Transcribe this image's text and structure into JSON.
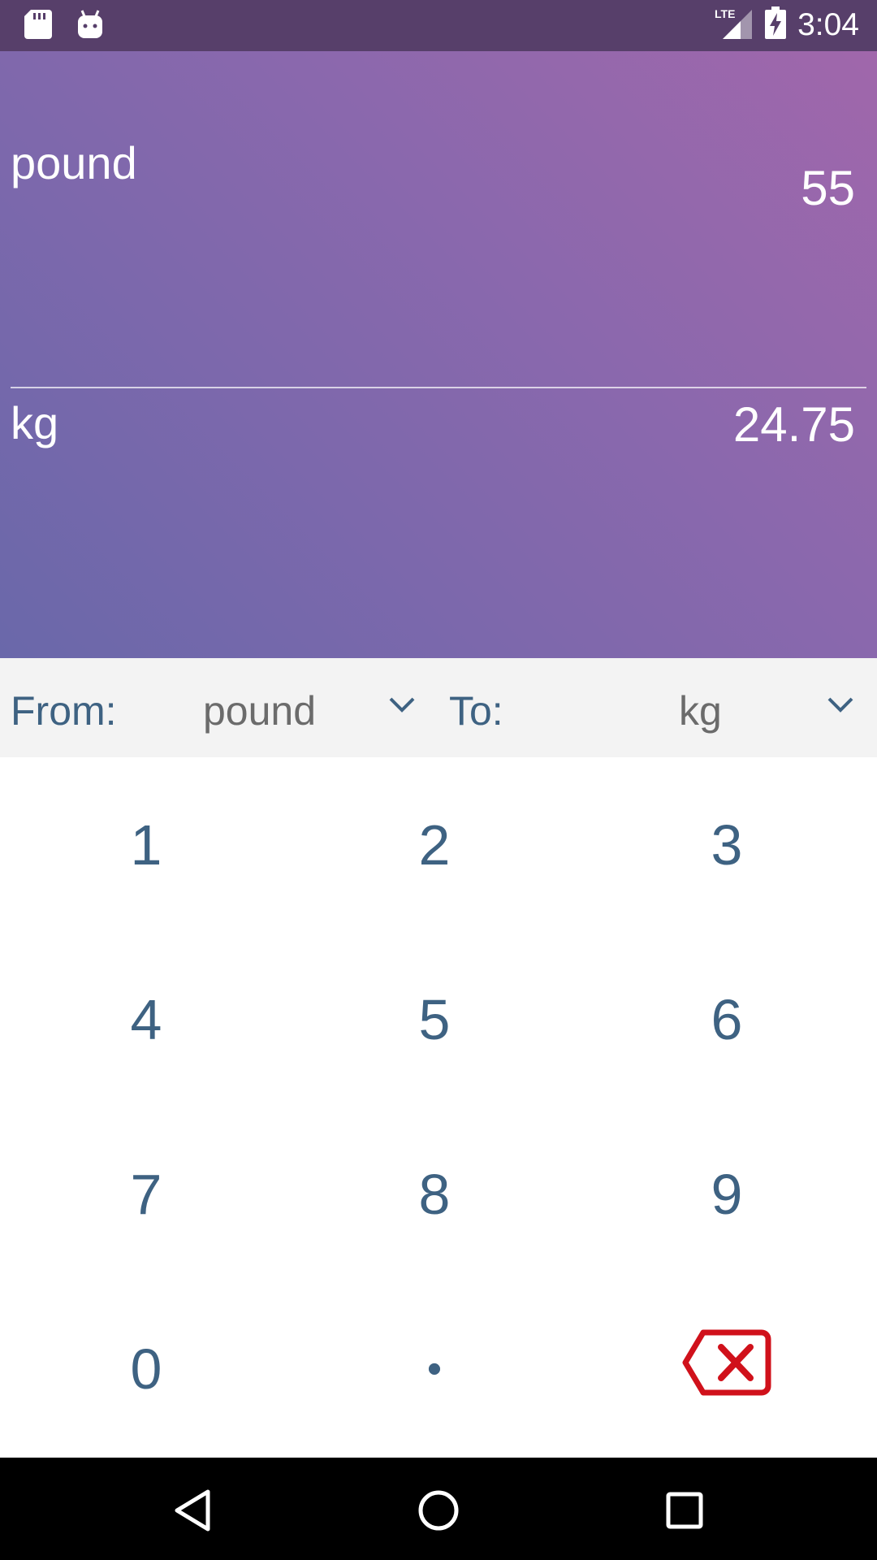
{
  "status_bar": {
    "time": "3:04",
    "network": "LTE",
    "icons": [
      "sd-card-icon",
      "android-icon",
      "lte-signal-icon",
      "battery-charging-icon"
    ]
  },
  "converter": {
    "from_unit": "pound",
    "from_value": "55",
    "to_unit": "kg",
    "to_value": "24.75"
  },
  "selector": {
    "from_label": "From:",
    "from_selected": "pound",
    "to_label": "To:",
    "to_selected": "kg"
  },
  "keypad": {
    "keys": [
      "1",
      "2",
      "3",
      "4",
      "5",
      "6",
      "7",
      "8",
      "9",
      "0",
      "•"
    ],
    "backspace_icon": "backspace-icon"
  },
  "nav": {
    "icons": [
      "back-icon",
      "home-icon",
      "recents-icon"
    ]
  },
  "colors": {
    "accent": "#3e6282",
    "backspace": "#d0111b",
    "gradient_start": "#6a68aa",
    "gradient_end": "#a067ab"
  }
}
